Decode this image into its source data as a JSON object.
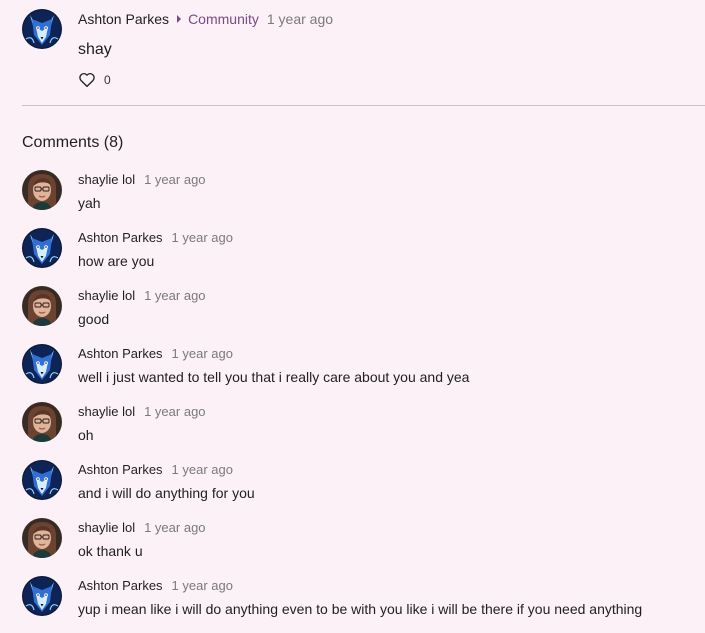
{
  "post": {
    "author": "Ashton Parkes",
    "community": "Community",
    "time": "1 year ago",
    "text": "shay",
    "like_count": "0",
    "avatar_icon": "wolf-avatar-icon"
  },
  "comments_heading": "Comments (8)",
  "comments": [
    {
      "author": "shaylie lol",
      "time": "1 year ago",
      "text": "yah",
      "avatar": "girl"
    },
    {
      "author": "Ashton Parkes",
      "time": "1 year ago",
      "text": "how are you",
      "avatar": "wolf"
    },
    {
      "author": "shaylie lol",
      "time": "1 year ago",
      "text": "good",
      "avatar": "girl"
    },
    {
      "author": "Ashton Parkes",
      "time": "1 year ago",
      "text": "well i just wanted to tell you that i really care about you and yea",
      "avatar": "wolf"
    },
    {
      "author": "shaylie lol",
      "time": "1 year ago",
      "text": "oh",
      "avatar": "girl"
    },
    {
      "author": "Ashton Parkes",
      "time": "1 year ago",
      "text": "and i will do anything for you",
      "avatar": "wolf"
    },
    {
      "author": "shaylie lol",
      "time": "1 year ago",
      "text": "ok thank u",
      "avatar": "girl"
    },
    {
      "author": "Ashton Parkes",
      "time": "1 year ago",
      "text": "yup i mean like i will do anything even to be with you like i will be there if you need anything",
      "avatar": "wolf"
    }
  ],
  "colors": {
    "background": "#fcf1f6",
    "community_link": "#7a4a86",
    "muted_text": "#7a7a7a"
  }
}
